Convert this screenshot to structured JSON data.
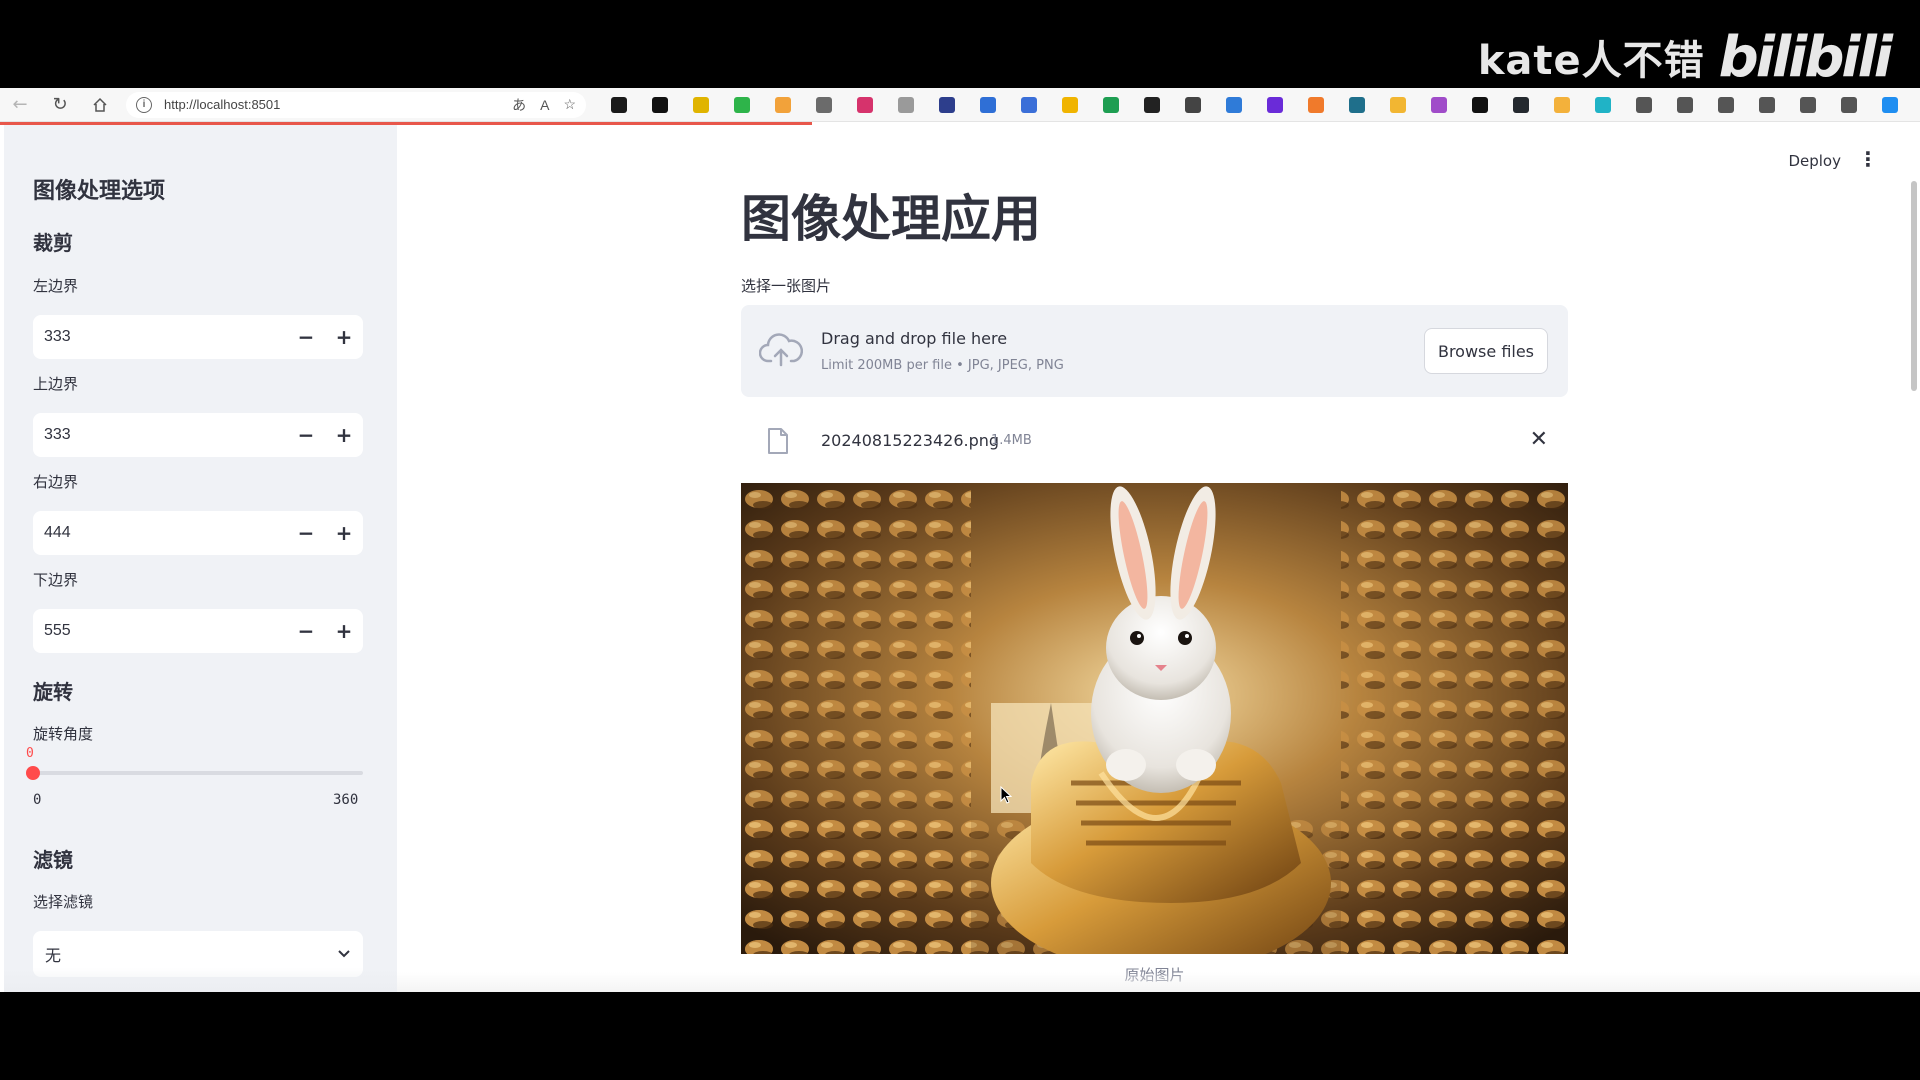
{
  "watermark": {
    "text": "kate人不错",
    "logo": "bilibili"
  },
  "browser": {
    "url": "http://localhost:8501",
    "extensions": [
      {
        "icon": "copilot-ext-icon",
        "color": "#1a1a1a"
      },
      {
        "icon": "notion-icon",
        "color": "#111111"
      },
      {
        "icon": "r-ext-icon",
        "color": "#e0b400"
      },
      {
        "icon": "pen-ext-icon",
        "color": "#2eb44a"
      },
      {
        "icon": "link-ext-icon",
        "color": "#f2a23a"
      },
      {
        "icon": "copy-ext-icon",
        "color": "#6b6b6b"
      },
      {
        "icon": "translate-ext-icon",
        "color": "#d6336c"
      },
      {
        "icon": "shield-ext-icon",
        "color": "#9a9a9a"
      },
      {
        "icon": "check-ext-icon",
        "color": "#2d3e8c"
      },
      {
        "icon": "globe-ext-icon",
        "color": "#2f6fd6"
      },
      {
        "icon": "chart-ext-icon",
        "color": "#3b6fd8"
      },
      {
        "icon": "bolt-ext-icon",
        "color": "#f0b400"
      },
      {
        "icon": "doc-ext-icon",
        "color": "#1e9e52"
      },
      {
        "icon": "chatgpt-icon",
        "color": "#222222"
      },
      {
        "icon": "keyboard-ext-icon",
        "color": "#444444"
      },
      {
        "icon": "bookmark-ext-icon",
        "color": "#2f7bd8"
      },
      {
        "icon": "feather-ext-icon",
        "color": "#6a2bd8"
      },
      {
        "icon": "circle-ext-icon",
        "color": "#f07a2b"
      },
      {
        "icon": "grid-ext-icon",
        "color": "#1f6f8b"
      },
      {
        "icon": "note-ext-icon",
        "color": "#f2b632"
      },
      {
        "icon": "image-ext-icon",
        "color": "#a04cc9"
      },
      {
        "icon": "x-icon",
        "color": "#111111"
      },
      {
        "icon": "github-icon",
        "color": "#24292f"
      },
      {
        "icon": "folder-ext-icon",
        "color": "#f3b13b"
      },
      {
        "icon": "box-ext-icon",
        "color": "#20b3c6"
      },
      {
        "icon": "puzzle-icon",
        "color": "#555555"
      },
      {
        "icon": "split-screen-icon",
        "color": "#555555"
      },
      {
        "icon": "favorites-icon",
        "color": "#555555"
      },
      {
        "icon": "collections-icon",
        "color": "#555555"
      },
      {
        "icon": "download-icon",
        "color": "#555555"
      },
      {
        "icon": "more-icon",
        "color": "#555555"
      },
      {
        "icon": "copilot-icon",
        "color": "#1f8ef1"
      }
    ]
  },
  "sidebar": {
    "title": "图像处理选项",
    "crop": {
      "heading": "裁剪",
      "left": {
        "label": "左边界",
        "value": "333"
      },
      "top": {
        "label": "上边界",
        "value": "333"
      },
      "right": {
        "label": "右边界",
        "value": "444"
      },
      "bottom": {
        "label": "下边界",
        "value": "555"
      }
    },
    "rotate": {
      "heading": "旋转",
      "label": "旋转角度",
      "value": "0",
      "min": "0",
      "max": "360"
    },
    "filter": {
      "heading": "滤镜",
      "label": "选择滤镜",
      "value": "无"
    },
    "step_minus": "−",
    "step_plus": "+"
  },
  "header": {
    "deploy": "Deploy"
  },
  "main": {
    "title": "图像处理应用",
    "uploader": {
      "label": "选择一张图片",
      "drag_text": "Drag and drop file here",
      "limit_text": "Limit 200MB per file • JPG, JPEG, PNG",
      "browse_label": "Browse files"
    },
    "file": {
      "name": "20240815223426.png",
      "size": "1.4MB"
    },
    "caption": "原始图片"
  },
  "colors": {
    "accent": "#ff4b4b",
    "sidebar_bg": "#f0f2f6",
    "text": "#31333f"
  }
}
